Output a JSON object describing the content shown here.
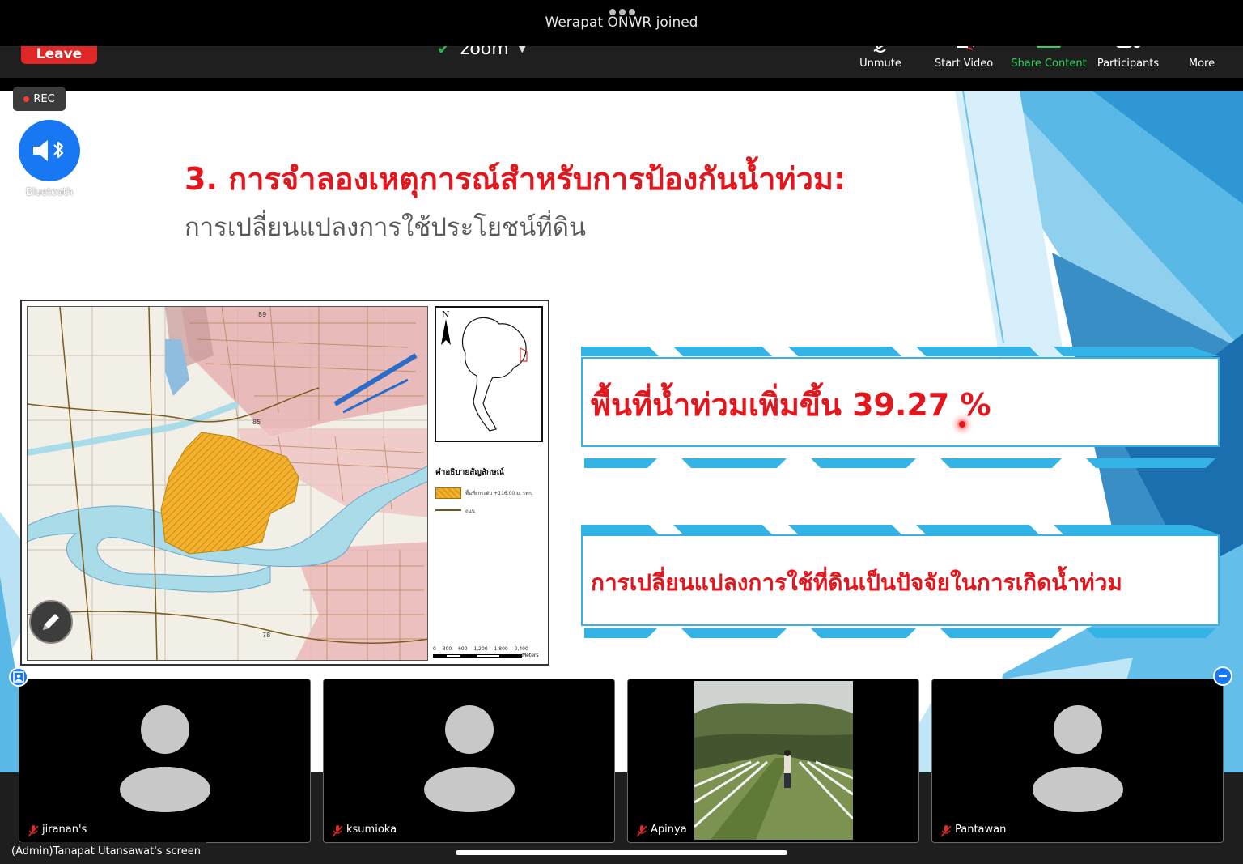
{
  "notification": {
    "message": "Werapat ONWR joined"
  },
  "toolbar": {
    "leave_label": "Leave",
    "app_name": "zoom",
    "items": [
      {
        "label": "Unmute",
        "icon": "muted-mic-icon"
      },
      {
        "label": "Start Video",
        "icon": "video-off-icon"
      },
      {
        "label": "Share Content",
        "icon": "share-screen-icon"
      },
      {
        "label": "Participants",
        "icon": "participants-icon"
      },
      {
        "label": "More",
        "icon": "more-icon"
      }
    ]
  },
  "recording": {
    "label": "REC",
    "color": "#ff3b30"
  },
  "audio": {
    "label": "Bluetooth",
    "icon": "bluetooth-speaker-icon"
  },
  "slide": {
    "title": "3. การจำลองเหตุการณ์สำหรับการป้องกันน้ำท่วม:",
    "subtitle": "การเปลี่ยนแปลงการใช้ประโยชน์ที่ดิน",
    "callout_1": "พื้นที่น้ำท่วมเพิ่มขึ้น 39.27 %",
    "callout_2": "การเปลี่ยนแปลงการใช้ที่ดินเป็นปัจจัยในการเกิดน้ำท่วม",
    "accent_color": "#e3161d",
    "map": {
      "north_label": "N",
      "legend_title": "คำอธิบายสัญลักษณ์",
      "legend_item_1": "พื้นที่ยกระดับ +116.00 ม. รทก.",
      "legend_item_2": "ถนน",
      "scale_ticks": "0 300 600 1,200 1,800 2,400",
      "scale_unit": "Meters"
    }
  },
  "participants": [
    {
      "name": "jiranan's",
      "muted": true,
      "video": false
    },
    {
      "name": "ksumioka",
      "muted": true,
      "video": false
    },
    {
      "name": "Apinya",
      "muted": true,
      "video": true
    },
    {
      "name": "Pantawan",
      "muted": true,
      "video": false
    }
  ],
  "screen_label": "(Admin)Tanapat Utansawat's screen"
}
